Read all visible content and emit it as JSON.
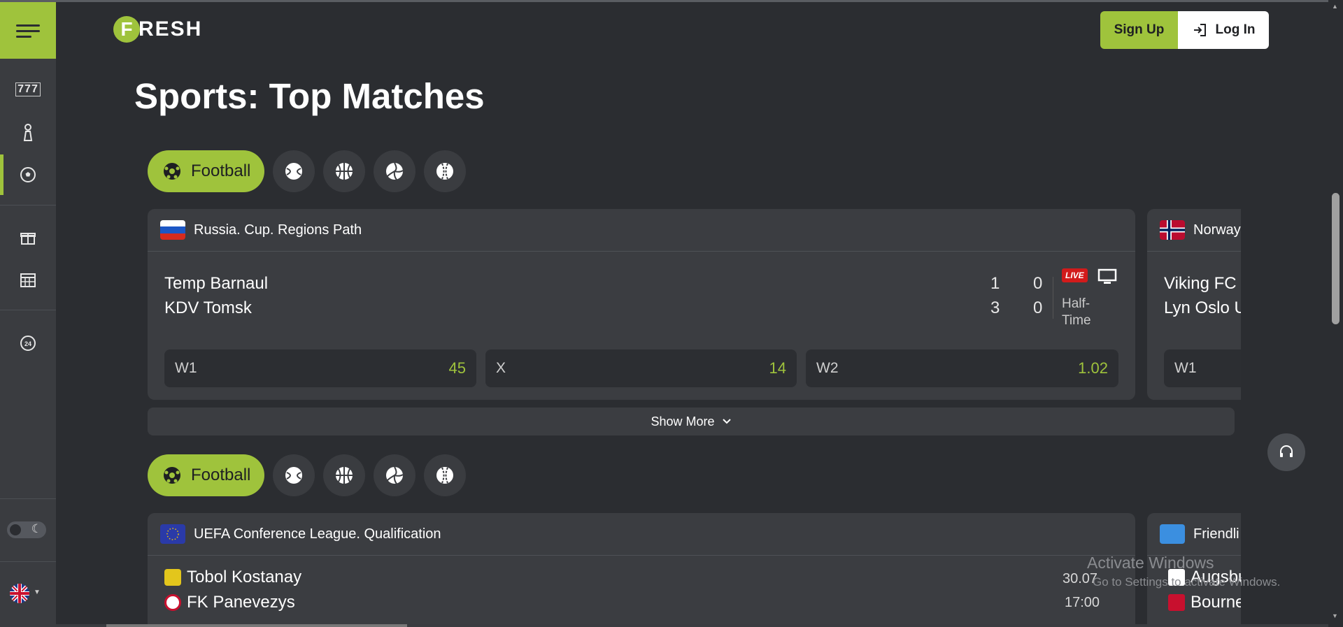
{
  "brand": {
    "logo_letter": "F",
    "logo_text": "RESH",
    "accent": "#9fc33c"
  },
  "header": {
    "signup_label": "Sign Up",
    "login_label": "Log In"
  },
  "sidebar": {
    "items": [
      {
        "name": "slots-icon",
        "glyph": "777"
      },
      {
        "name": "live-casino-icon",
        "glyph": "♟"
      },
      {
        "name": "sports-icon",
        "glyph": "⚽"
      },
      {
        "name": "promotions-icon",
        "glyph": "🎁"
      },
      {
        "name": "calendar-icon",
        "glyph": "▦"
      },
      {
        "name": "support-24-icon",
        "glyph": "24"
      }
    ]
  },
  "page_title": "Sports: Top Matches",
  "sections": [
    {
      "tab_active": "Football",
      "match_main": {
        "league": "Russia. Cup. Regions Path",
        "team1": "Temp Barnaul",
        "team2": "KDV Tomsk",
        "score1": [
          "1",
          "0"
        ],
        "score2": [
          "3",
          "0"
        ],
        "live_badge": "LIVE",
        "status": "Half-Time",
        "odds": [
          {
            "label": "W1",
            "value": "45"
          },
          {
            "label": "X",
            "value": "14"
          },
          {
            "label": "W2",
            "value": "1.02"
          }
        ]
      },
      "match_side": {
        "league": "Norway",
        "team1": "Viking FC U",
        "team2": "Lyn Oslo U",
        "odd_label": "W1"
      },
      "show_more": "Show More"
    },
    {
      "tab_active": "Football",
      "match_main": {
        "league": "UEFA Conference League. Qualification",
        "team1": "Tobol Kostanay",
        "team2": "FK Panevezys",
        "date": "30.07",
        "time": "17:00"
      },
      "match_side": {
        "league": "Friendli",
        "team1": "Augsbu",
        "team2": "Bourne"
      }
    }
  ],
  "watermark": {
    "line1": "Activate Windows",
    "line2": "Go to Settings to activate Windows."
  }
}
